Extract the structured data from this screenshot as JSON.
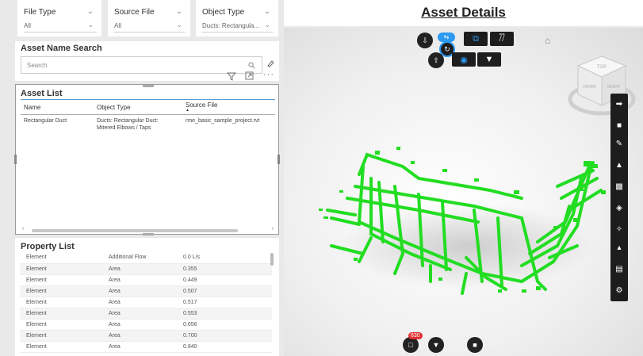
{
  "filters": [
    {
      "title": "File Type",
      "value": "All"
    },
    {
      "title": "Source File",
      "value": "All"
    },
    {
      "title": "Object Type",
      "value": "Ducts: Rectangula..."
    }
  ],
  "search": {
    "title": "Asset Name Search",
    "placeholder": "Search"
  },
  "asset_list": {
    "title": "Asset List",
    "columns": [
      "Name",
      "Object Type",
      "Source File"
    ],
    "rows": [
      {
        "name": "Rectangular Duct",
        "object_type_line1": "Ducts: Rectangular Duct:",
        "object_type_line2": "Mitered Elbows / Taps",
        "source_file": "rme_basic_sample_project.rvt"
      }
    ]
  },
  "property_list": {
    "title": "Property List",
    "rows": [
      [
        "Element",
        "Additional Flow",
        "0.0 L/s"
      ],
      [
        "Element",
        "Area",
        "0.355"
      ],
      [
        "Element",
        "Area",
        "0.449"
      ],
      [
        "Element",
        "Area",
        "0.507"
      ],
      [
        "Element",
        "Area",
        "0.517"
      ],
      [
        "Element",
        "Area",
        "0.553"
      ],
      [
        "Element",
        "Area",
        "0.656"
      ],
      [
        "Element",
        "Area",
        "0.700"
      ],
      [
        "Element",
        "Area",
        "0.840"
      ]
    ]
  },
  "viewer": {
    "title": "Asset Details",
    "badge_count": "630",
    "model_color": "#22dd22",
    "accent_color": "#2b9af3",
    "viewcube": {
      "top": "TOP",
      "front": "FRONT",
      "right": "RIGHT"
    }
  }
}
